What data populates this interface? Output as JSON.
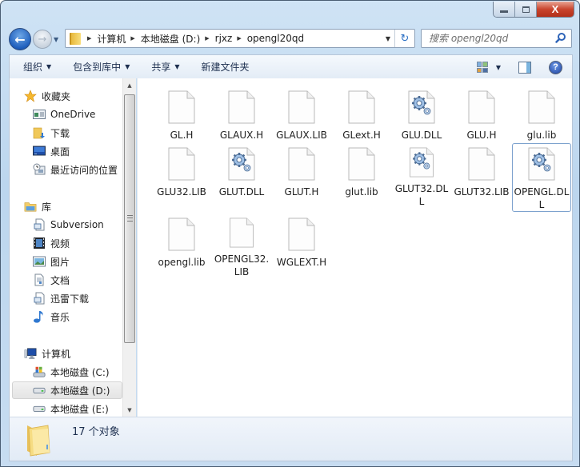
{
  "window": {
    "caption_buttons": [
      "minimize",
      "maximize",
      "close"
    ],
    "close_glyph": "X"
  },
  "nav": {
    "back_icon": "back-arrow-icon",
    "forward_icon": "forward-arrow-icon",
    "back_glyph": "←",
    "forward_glyph": "→",
    "history_glyph": "▼"
  },
  "address": {
    "breadcrumbs": [
      "计算机",
      "本地磁盘 (D:)",
      "rjxz",
      "opengl20qd"
    ],
    "arrow_glyph": "▶",
    "dropdown_glyph": "▼",
    "refresh_glyph": "↻"
  },
  "search": {
    "placeholder": "搜索 opengl20qd",
    "value": ""
  },
  "toolbar": {
    "items": [
      {
        "label": "组织",
        "has_menu": true
      },
      {
        "label": "包含到库中",
        "has_menu": true
      },
      {
        "label": "共享",
        "has_menu": true
      },
      {
        "label": "新建文件夹",
        "has_menu": false
      }
    ],
    "caret_glyph": "▼",
    "help_glyph": "?"
  },
  "sidebar": {
    "favorites": {
      "label": "收藏夹",
      "icon": "star-icon"
    },
    "favorites_items": [
      {
        "label": "OneDrive",
        "icon": "onedrive-icon"
      },
      {
        "label": "下载",
        "icon": "downloads-icon"
      },
      {
        "label": "桌面",
        "icon": "desktop-icon"
      },
      {
        "label": "最近访问的位置",
        "icon": "recent-places-icon"
      }
    ],
    "libraries": {
      "label": "库",
      "icon": "library-icon"
    },
    "libraries_items": [
      {
        "label": "Subversion",
        "icon": "library-doc-icon"
      },
      {
        "label": "视频",
        "icon": "video-icon"
      },
      {
        "label": "图片",
        "icon": "pictures-icon"
      },
      {
        "label": "文档",
        "icon": "documents-icon"
      },
      {
        "label": "迅雷下载",
        "icon": "library-doc-icon"
      },
      {
        "label": "音乐",
        "icon": "music-icon"
      }
    ],
    "computer": {
      "label": "计算机",
      "icon": "computer-icon"
    },
    "computer_items": [
      {
        "label": "本地磁盘 (C:)",
        "icon": "system-drive-icon",
        "selected": false
      },
      {
        "label": "本地磁盘 (D:)",
        "icon": "drive-icon",
        "selected": true
      },
      {
        "label": "本地磁盘 (E:)",
        "icon": "drive-icon",
        "selected": false
      }
    ]
  },
  "files": [
    {
      "name": "GL.H",
      "type": "generic"
    },
    {
      "name": "GLAUX.H",
      "type": "generic"
    },
    {
      "name": "GLAUX.LIB",
      "type": "generic"
    },
    {
      "name": "GLext.H",
      "type": "generic"
    },
    {
      "name": "GLU.DLL",
      "type": "dll"
    },
    {
      "name": "GLU.H",
      "type": "generic"
    },
    {
      "name": "glu.lib",
      "type": "generic"
    },
    {
      "name": "GLU32.LIB",
      "type": "generic"
    },
    {
      "name": "GLUT.DLL",
      "type": "dll"
    },
    {
      "name": "GLUT.H",
      "type": "generic"
    },
    {
      "name": "glut.lib",
      "type": "generic"
    },
    {
      "name": "GLUT32.DLL",
      "type": "dll"
    },
    {
      "name": "GLUT32.LIB",
      "type": "generic"
    },
    {
      "name": "OPENGL.DLL",
      "type": "dll",
      "focused": true
    },
    {
      "name": "opengl.lib",
      "type": "generic"
    },
    {
      "name": "OPENGL32.LIB",
      "type": "generic"
    },
    {
      "name": "WGLEXT.H",
      "type": "generic"
    }
  ],
  "status": {
    "text": "17 个对象"
  },
  "colors": {
    "frame": "#c7dcf1",
    "close_button": "#c9452e",
    "focus_border": "#7da2ce",
    "toolbar_text": "#1e3050"
  }
}
